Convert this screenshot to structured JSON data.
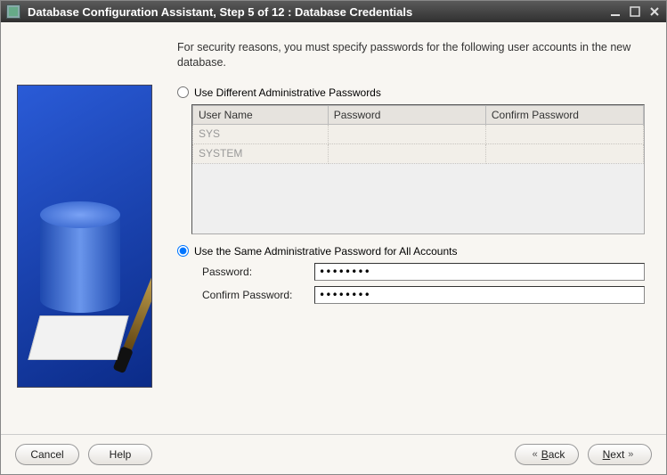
{
  "window": {
    "title": "Database Configuration Assistant, Step 5 of 12 : Database Credentials"
  },
  "instruction": "For security reasons, you must specify passwords for the following user accounts in the new database.",
  "options": {
    "diff_label": "Use Different Administrative Passwords",
    "same_label": "Use the Same Administrative Password for All Accounts",
    "selected": "same"
  },
  "table": {
    "headers": [
      "User Name",
      "Password",
      "Confirm Password"
    ],
    "rows": [
      {
        "user": "SYS",
        "password": "",
        "confirm": ""
      },
      {
        "user": "SYSTEM",
        "password": "",
        "confirm": ""
      }
    ]
  },
  "fields": {
    "password_label": "Password:",
    "confirm_label": "Confirm Password:",
    "password_value": "********",
    "confirm_value": "********"
  },
  "buttons": {
    "cancel": "Cancel",
    "help": "Help",
    "back": "Back",
    "next": "Next"
  }
}
